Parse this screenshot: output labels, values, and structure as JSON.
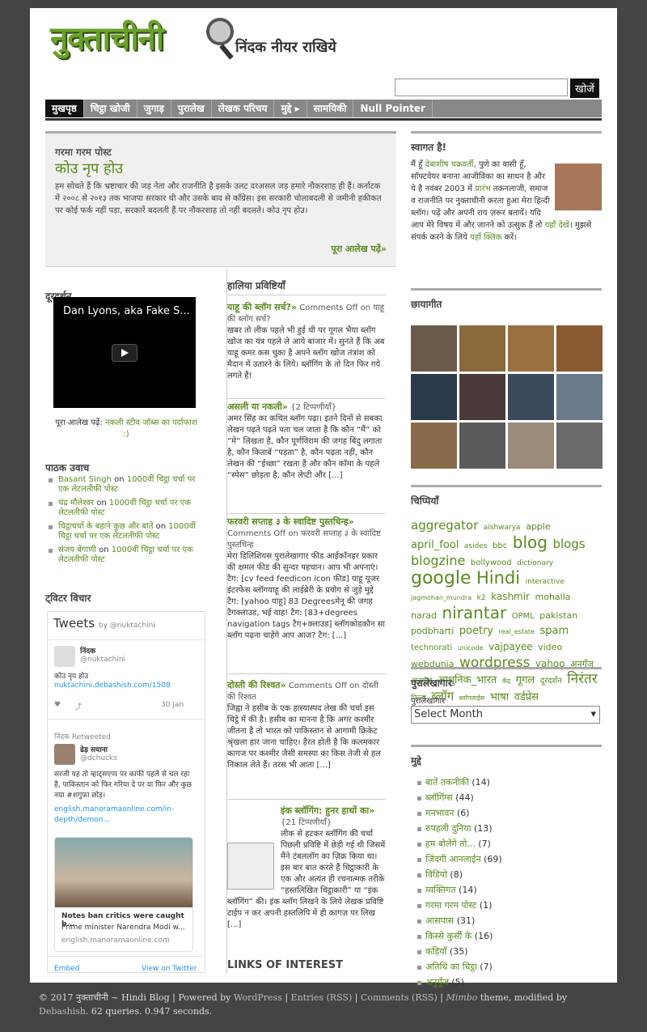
{
  "header": {
    "logo": "नुक्ताचीनी",
    "tagline": "निंदक नीयर राखिये",
    "search_button": "खोजें",
    "search_placeholder": ""
  },
  "nav": [
    "मुखपृष्ठ",
    "चिट्ठा खोजी",
    "जुगाड़",
    "पुरालेख",
    "लेखक परिचय",
    "मुद्दे ▸",
    "सामयिकी",
    "Null Pointer"
  ],
  "featured": {
    "label": "गरमा गरम पोस्ट",
    "title": "कोउ नृप होउ",
    "body": "हम सोचते हैं कि भ्रष्टाचार की जड़ नेता और राजनीति है इसके उलट दरअसल जड़ हमारे नौकरशाह ही हैं। कर्नाटक में २००८ से २०१३ तक भाजपा सरकार थी और उसके बाद से कॉंग्रेस। इस सरकारी चोलाबदली से जमीनी हकीकत पर कोई फर्क नहीं पड़ा, सरकारें बदलती हैं पर नौकरशाह तो नहीं बदलते। कोउ नृप होउ।",
    "more": "पूरा आलेख पढ़ें»"
  },
  "doordarshan": {
    "heading": "दूरदर्शन",
    "video_title": "Dan Lyons, aka Fake S...",
    "caption_prefix": "पूरा आलेख पढ़ें: ",
    "caption_link": "नकली स्टीव जॉब्स का पर्दाफाश :)"
  },
  "reader_comments": {
    "heading": "पाठक उवाच",
    "items": [
      {
        "author": "Basant Singh",
        "on": " on ",
        "post": "1000वीं चिट्ठा चर्चा पर एक लेटलतीफी पोस्ट"
      },
      {
        "author": "चंद्र मौलेश्वर",
        "on": " on ",
        "post": "1000वीं चिट्ठा चर्चा पर एक लेटलतीफी पोस्ट"
      },
      {
        "author": "चिट्ठाचर्चा के बहाने कुछ और बातें",
        "on": " on ",
        "post": "1000वीं चिट्ठा चर्चा पर एक लेटलतीफी पोस्ट"
      },
      {
        "author": "संजय बेंगाणी",
        "on": " on ",
        "post": "1000वीं चिट्ठा चर्चा पर एक लेटलतीफी पोस्ट"
      }
    ]
  },
  "twitter": {
    "heading": "ट्विटर विचार",
    "title": "Tweets",
    "by": "by @nuktachini",
    "tweet1_name": "निंदक",
    "tweet1_handle": "@nuktachini",
    "tweet1_text": "कोउ नृप होउ",
    "tweet1_link": "nuktachini.debashish.com/1508",
    "tweet1_date": "30 Jan",
    "retweet_label": "निंदक Retweeted",
    "tweet2_name": "ढेड़ सयाना",
    "tweet2_handle": "@dchucks",
    "tweet2_text": "सरजी यह तो व्हाट्सएप्प पर काफी पहले से चल रहा है, पाकिस्तान को फिर गरिया दे पर या फिर और कुछ नया #शगुफा छोड़।",
    "tweet2_link": "english.manoramaonline.com/in-depth/demon...",
    "card_title": "Notes ban critics were caught b...",
    "card_desc": "Prime minister Narendra Modi w...",
    "card_domain": "english.manoramaonline.com",
    "embed": "Embed",
    "view": "View on Twitter"
  },
  "recent": {
    "heading": "हालिया प्रविष्टियाँ",
    "posts": [
      {
        "title": "याहू की ब्लॉग सर्च?»",
        "meta": " Comments Off on याहू की ब्लॉग सर्च?",
        "body": "खबर तो लीक पहले भी हुई थी पर गूगल भैया ब्लॉग खोज का यंत्र पहले ले आये बाजार में। सुनते हैं कि अब याहू कमर कस चुका है अपने ब्लॉग खोज तंत्रांश को मैदान में उतारने के लिये। ब्लॉगिंग के तो दिन फिर गये लगते हैं!"
      },
      {
        "title": "असली या नकली»",
        "meta": " {2 टिप्पणीयाँ}",
        "body": "अमर सिंह का कथित ब्लॉग पढ़ा। इतने दिनों से सबका लेखन पढ़ते पढ़ते पता चल जाता है कि कौन “मैं” को “मे” लिखता है, कौन पूर्णविराम की जगह बिंदु लगाता है, कौन किताबें “पड़ता” है, कौन पढ़ता नहीं, कौन लेखन की “ईच्छा” रखता है और कौन कॉमा के पहले “स्पेस” छोड़ता है, कौन लेप्टी और [...]"
      },
      {
        "title": "फरवरी सप्ताह ३ के स्वादिष्ट पुस्तचिन्ह»",
        "meta": " Comments Off on फरवरी सप्ताह ३ के स्वादिष्ट पुस्तचिन्ह",
        "body": "मेरा डिलिशियस पुरालेखागार फीड आईकॉनहर प्रकार की क्षमल फीड की सुन्दर पहचान। आप भी अपनाएं। टैग: [cv feed feedicon icon फीड] याहू यूजर इंटरफेस ब्लॉगयाहू की लाईब्रेरी के प्रयोग से जुड़े मुद्दे टैग: [yahoo याहू] 83 Degreesमेनू की जगह टैगक्लाउड, भई वाह! टैग: [83+degrees navigation tags टैग+क्लाउड] ब्लॉगकोडकौन सा ब्लॉग पढ़ना चाहेंगे आप आज? टैग: [...]"
      },
      {
        "title": "दोस्ती की रिश्वत»",
        "meta": " Comments Off on दोस्ती की रिश्वत",
        "body": "जिह्वा ने हसीब के एक हास्यास्पद लेख की चर्चा इस चिट्ठे में की है। हसीब का मानना है कि अगर कश्मीर जीतना है तो भारत को पाकिस्तान से आगामी क्रिकेट श्रृंखला हार जाना चाहिए। हैरत होती है कि कलमकार कागज पर कश्मीर जैसी समस्या का किस तेजी से हल निकाल लेते हैं। तरस भी आता [...]"
      },
      {
        "title": "इंक ब्लॉगिंग: हुनर हाथों का»",
        "meta": " {21 टिप्पणीयाँ}",
        "body": "लीक से हटकर ब्लॉगिंग की चर्चा पिछली प्रविष्टि में छेड़ी गई थी जिसमें मैंने टंबललॉग का ज़िक्र किया था। इस बार बात करते हैं चिट्ठाकारी के एक और अत्यंत ही रचनात्मक तरीके “हस्तलिखित चिट्ठाकारी” या “इंक ब्लॉगिंग” की। इंक ब्लॉग लिखने के लिये लेखक प्रविष्टि टाईप न कर अपनी हस्तलिपि में ही कागज़ पर लिख [...]"
      }
    ],
    "links_heading": "LINKS OF INTEREST"
  },
  "welcome": {
    "heading": "स्वागत है!",
    "text_1": "मैं हूँ ",
    "name": "देबाशीष चक्रवर्ती",
    "text_2": ", पुणे का वासी हूँ, सॉफ्टवेयर बनाना आजीविका का साधन है और ये है नवंबर 2003 में ",
    "link_1": "प्रारंभ",
    "text_3": " तकनलाजी, समाज व राजनीति पर नुक्ताचीनी करता हुआ मेरा हिन्दी ब्लॉग। पढ़ें और अपनी राय ज़रूर बतायें। यदि आप मेरे विषय में और जानने को उत्सुक हैं तो ",
    "link_2": "यहाँ देखें",
    "text_4": "। मुझसे संपर्क करने के लिये ",
    "link_3": "यहाँ क्लिक",
    "text_5": " करें।"
  },
  "photos": {
    "heading": "छायागीत",
    "colors": [
      "#6b5a4a",
      "#8a6a3a",
      "#9a7040",
      "#8a5a30",
      "#2a3a4a",
      "#4a3a3a",
      "#3a4a5a",
      "#6a7a8a",
      "#8a6a4a",
      "#5a5a5a",
      "#9a8a7a",
      "#6a6a6a"
    ]
  },
  "tags": {
    "heading": "चिप्पियाँ",
    "items": [
      {
        "t": "aggregator",
        "s": 15
      },
      {
        "t": "aishwarya",
        "s": 9
      },
      {
        "t": "apple",
        "s": 11
      },
      {
        "t": "april_fool",
        "s": 13
      },
      {
        "t": "asides",
        "s": 9
      },
      {
        "t": "bbc",
        "s": 10
      },
      {
        "t": "blog",
        "s": 20
      },
      {
        "t": "blogs",
        "s": 15
      },
      {
        "t": "blogzine",
        "s": 16
      },
      {
        "t": "bollywood",
        "s": 10
      },
      {
        "t": "dictionary",
        "s": 9
      },
      {
        "t": "google",
        "s": 22
      },
      {
        "t": "Hindi",
        "s": 21
      },
      {
        "t": "interactive",
        "s": 9
      },
      {
        "t": "jagmohan_mundra",
        "s": 8
      },
      {
        "t": "k2",
        "s": 9
      },
      {
        "t": "kashmir",
        "s": 12
      },
      {
        "t": "mohalla",
        "s": 11
      },
      {
        "t": "narad",
        "s": 11
      },
      {
        "t": "nirantar",
        "s": 20
      },
      {
        "t": "OPML",
        "s": 10
      },
      {
        "t": "pakistan",
        "s": 11
      },
      {
        "t": "podbharti",
        "s": 11
      },
      {
        "t": "poetry",
        "s": 13
      },
      {
        "t": "real_estate",
        "s": 8
      },
      {
        "t": "spam",
        "s": 13
      },
      {
        "t": "technorati",
        "s": 10
      },
      {
        "t": "unicode",
        "s": 8
      },
      {
        "t": "vajpayee",
        "s": 12
      },
      {
        "t": "video",
        "s": 11
      },
      {
        "t": "webdunia",
        "s": 11
      },
      {
        "t": "wordpress",
        "s": 17
      },
      {
        "t": "yahoo",
        "s": 12
      },
      {
        "t": "अनुगूँज",
        "s": 11
      },
      {
        "t": "अनुगूंज",
        "s": 10
      },
      {
        "t": "आधुनिक_भारत",
        "s": 13
      },
      {
        "t": "केंद्र",
        "s": 8
      },
      {
        "t": "गूगल",
        "s": 13
      },
      {
        "t": "दूरदर्शन",
        "s": 10
      },
      {
        "t": "निरंतर",
        "s": 17
      },
      {
        "t": "फिल्म",
        "s": 9
      },
      {
        "t": "ब्लॉग",
        "s": 15
      },
      {
        "t": "ब्लॉगलाईस",
        "s": 8
      },
      {
        "t": "भाषा",
        "s": 13
      },
      {
        "t": "वर्डप्रेस",
        "s": 13
      }
    ]
  },
  "archive": {
    "heading": "पुरालेखागार",
    "label": "पुरालेखागार",
    "select": "Select Month"
  },
  "categories": {
    "heading": "मुद्दे",
    "items": [
      {
        "name": "बातें तकनीकी",
        "count": " (14)"
      },
      {
        "name": "ब्लॉगिंग्स",
        "count": " (44)"
      },
      {
        "name": "मनभावन",
        "count": " (6)"
      },
      {
        "name": "रुपहली दुनिया",
        "count": " (13)"
      },
      {
        "name": "हम बोलेंगे तो...",
        "count": " (7)"
      },
      {
        "name": "ज़िंदगी आनलाईन",
        "count": " (69)"
      },
      {
        "name": "विडियो",
        "count": " (8)"
      },
      {
        "name": "व्यक्तिगत",
        "count": " (14)"
      },
      {
        "name": "गरमा गरम पोस्ट",
        "count": " (1)"
      },
      {
        "name": "आसपास",
        "count": " (31)"
      },
      {
        "name": "किस्से कुर्सी के",
        "count": " (16)"
      },
      {
        "name": "कड़ियाँ",
        "count": " (35)"
      },
      {
        "name": "अतिथि का चिट्ठा",
        "count": " (7)"
      },
      {
        "name": "अनुगूँज",
        "count": " (5)"
      }
    ]
  },
  "footer": {
    "copy": "© 2017 नुक्ताचीनी ~ Hindi Blog | Powered by ",
    "wp": "WordPress",
    "sep1": " | ",
    "entries": "Entries (RSS)",
    "sep2": " | ",
    "comments": "Comments (RSS)",
    "sep3": " | ",
    "theme": "Mimbo",
    "rest": " theme, modified by ",
    "author": "Debashish",
    "stats": ". 62 queries. 0.947 seconds."
  }
}
